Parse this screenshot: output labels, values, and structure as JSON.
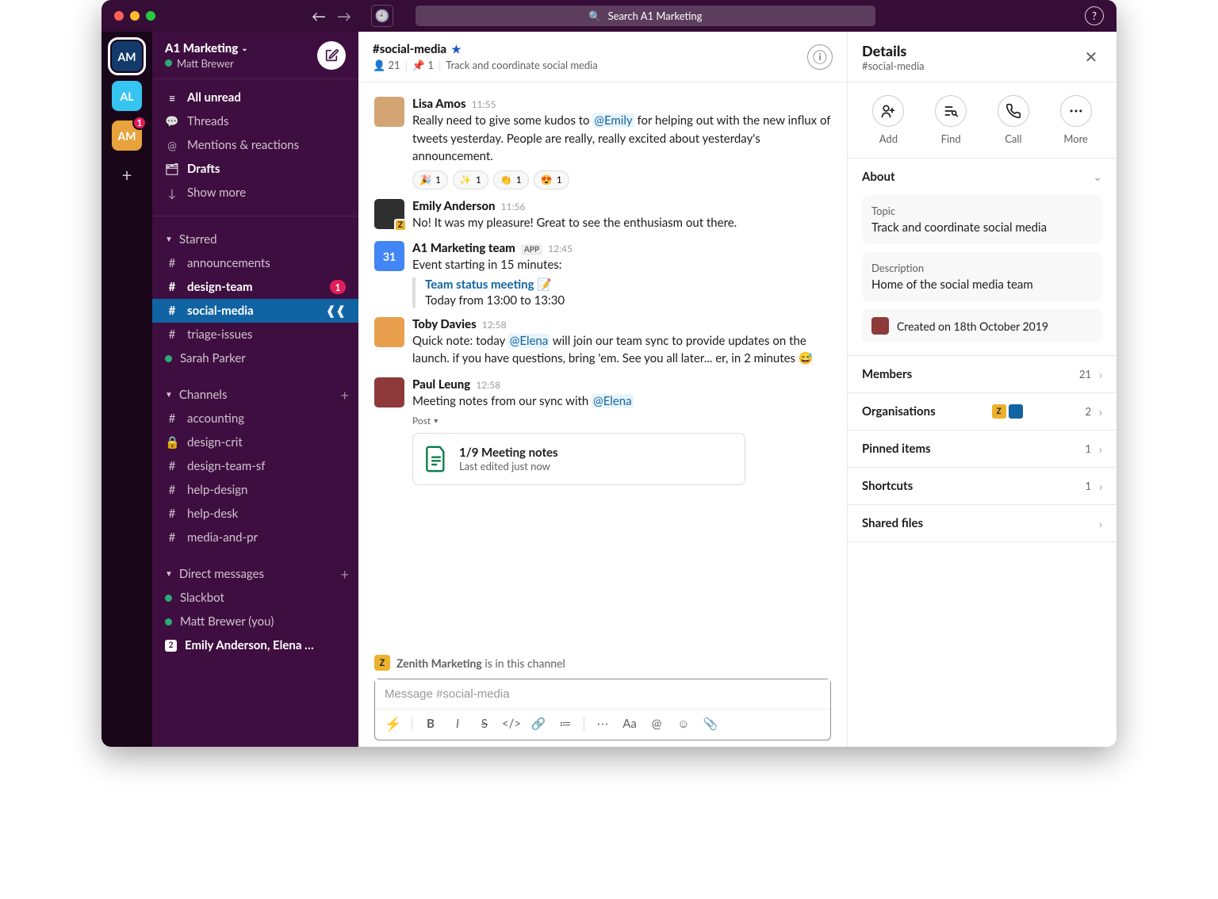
{
  "titlebar": {
    "search_placeholder": "Search A1 Marketing"
  },
  "rail": {
    "workspaces": [
      {
        "code": "AM",
        "color": "#143a6b",
        "active": true
      },
      {
        "code": "AL",
        "color": "#36c5f0"
      },
      {
        "code": "AM",
        "color": "#e8a33d",
        "badge": "1"
      }
    ]
  },
  "sidebar": {
    "workspace_name": "A1 Marketing",
    "user_name": "Matt Brewer",
    "compose_icon": "✎",
    "nav": [
      {
        "icon": "≡",
        "label": "All unread",
        "bold": true
      },
      {
        "icon": "💬",
        "label": "Threads"
      },
      {
        "icon": "@",
        "label": "Mentions & reactions"
      },
      {
        "icon": "🗂",
        "label": "Drafts",
        "bold": true
      },
      {
        "icon": "↓",
        "label": "Show more"
      }
    ],
    "starred_heading": "Starred",
    "starred": [
      {
        "prefix": "#",
        "label": "announcements"
      },
      {
        "prefix": "#",
        "label": "design-team",
        "bold": true,
        "badge": "1"
      },
      {
        "prefix": "#",
        "label": "social-media",
        "selected": true,
        "trailing": "❰❰"
      },
      {
        "prefix": "#",
        "label": "triage-issues"
      },
      {
        "prefix": "●",
        "label": "Sarah Parker",
        "presence": "active"
      }
    ],
    "channels_heading": "Channels",
    "channels": [
      {
        "prefix": "#",
        "label": "accounting"
      },
      {
        "prefix": "🔒",
        "label": "design-crit"
      },
      {
        "prefix": "#",
        "label": "design-team-sf"
      },
      {
        "prefix": "#",
        "label": "help-design"
      },
      {
        "prefix": "#",
        "label": "help-desk"
      },
      {
        "prefix": "#",
        "label": "media-and-pr"
      }
    ],
    "dm_heading": "Direct messages",
    "dms": [
      {
        "type": "presence",
        "presence": "active",
        "label": "Slackbot"
      },
      {
        "type": "presence",
        "presence": "active",
        "label": "Matt Brewer (you)"
      },
      {
        "type": "count",
        "count": "2",
        "label": "Emily Anderson, Elena …",
        "bold": true
      }
    ]
  },
  "channel": {
    "name": "#social-media",
    "member_count": "21",
    "pin_count": "1",
    "topic": "Track and coordinate social media"
  },
  "messages": [
    {
      "avatar": "lisa",
      "author": "Lisa Amos",
      "time": "11:55",
      "segments": [
        {
          "t": "text",
          "v": "Really need to give some kudos to "
        },
        {
          "t": "mention",
          "v": "@Emily"
        },
        {
          "t": "text",
          "v": " for helping out with the new influx of tweets yesterday. People are really, really excited about yesterday's announcement."
        }
      ],
      "reactions": [
        {
          "emoji": "🎉",
          "count": 1
        },
        {
          "emoji": "✨",
          "count": 1
        },
        {
          "emoji": "👏",
          "count": 1
        },
        {
          "emoji": "😍",
          "count": 1
        }
      ]
    },
    {
      "avatar": "emily",
      "author": "Emily Anderson",
      "time": "11:56",
      "segments": [
        {
          "t": "text",
          "v": "No! It was my pleasure! Great to see the enthusiasm out there."
        }
      ]
    },
    {
      "avatar": "cal",
      "author": "A1 Marketing team",
      "app": true,
      "time": "12:45",
      "segments": [
        {
          "t": "text",
          "v": "Event starting in 15 minutes:"
        }
      ],
      "event": {
        "title": "Team status meeting",
        "emoji": "📝",
        "time": "Today from 13:00 to 13:30"
      }
    },
    {
      "avatar": "toby",
      "author": "Toby Davies",
      "time": "12:58",
      "segments": [
        {
          "t": "text",
          "v": "Quick note: today "
        },
        {
          "t": "mention",
          "v": "@Elena"
        },
        {
          "t": "text",
          "v": " will join our team sync to provide updates on the launch. if you have questions, bring 'em. See you all later... er, in 2 minutes 😅"
        }
      ]
    },
    {
      "avatar": "paul",
      "author": "Paul Leung",
      "time": "12:58",
      "segments": [
        {
          "t": "text",
          "v": "Meeting notes from our sync with "
        },
        {
          "t": "mention",
          "v": "@Elena"
        }
      ],
      "post_label": "Post",
      "attachment": {
        "title": "1/9 Meeting notes",
        "subtitle": "Last edited just now"
      }
    }
  ],
  "notice": {
    "org": "Zenith Marketing",
    "suffix": " is in this channel"
  },
  "composer": {
    "placeholder": "Message #social-media"
  },
  "details": {
    "title": "Details",
    "subtitle": "#social-media",
    "actions": [
      {
        "icon": "add",
        "label": "Add"
      },
      {
        "icon": "find",
        "label": "Find"
      },
      {
        "icon": "call",
        "label": "Call"
      },
      {
        "icon": "more",
        "label": "More"
      }
    ],
    "about_heading": "About",
    "about": {
      "topic_label": "Topic",
      "topic_value": "Track and coordinate social media",
      "desc_label": "Description",
      "desc_value": "Home of the social media team",
      "created": "Created on 18th October 2019"
    },
    "sections": [
      {
        "label": "Members",
        "count": "21"
      },
      {
        "label": "Organisations",
        "count": "2",
        "orgs": true
      },
      {
        "label": "Pinned items",
        "count": "1"
      },
      {
        "label": "Shortcuts",
        "count": "1"
      },
      {
        "label": "Shared files"
      }
    ]
  }
}
